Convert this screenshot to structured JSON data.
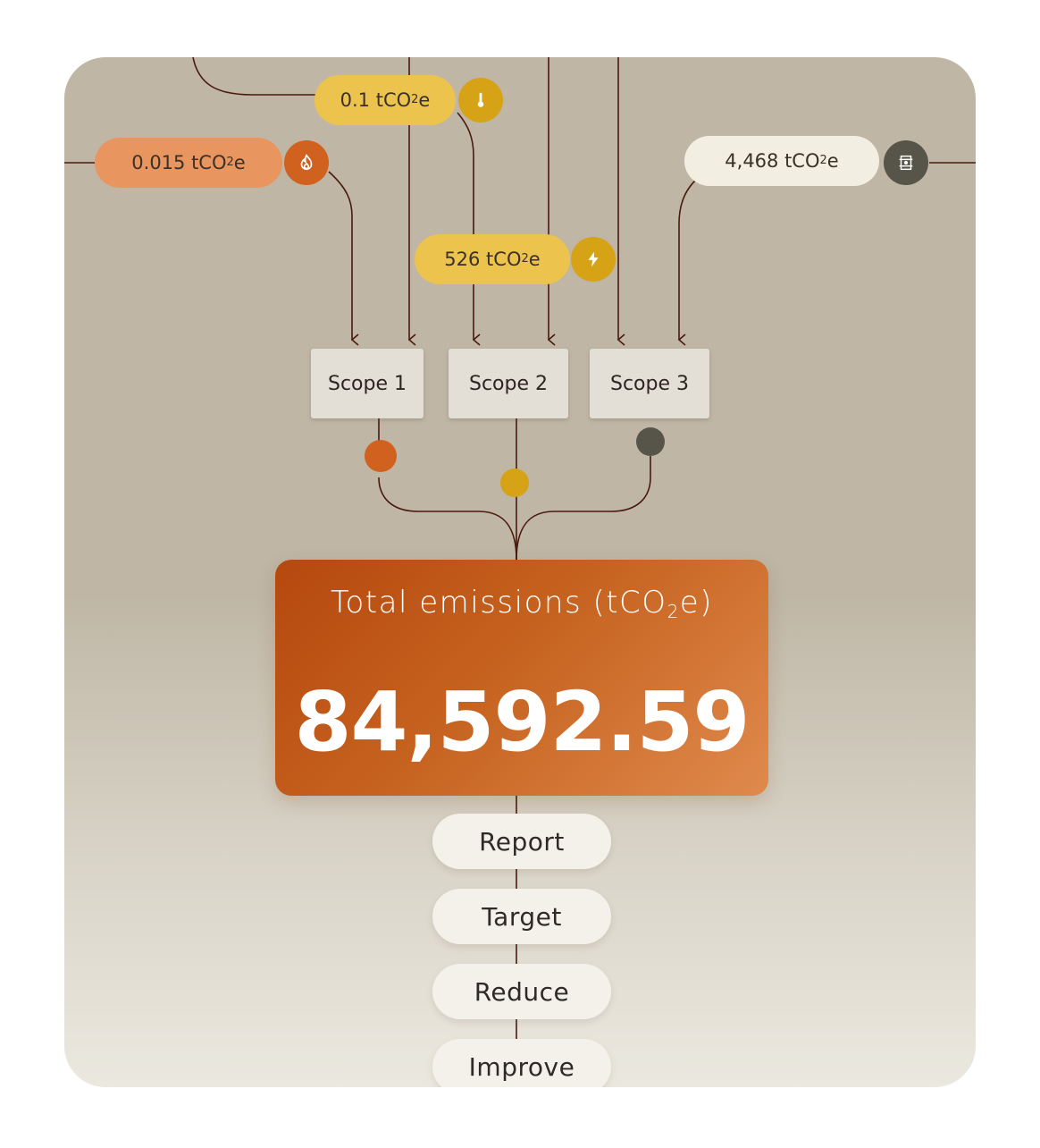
{
  "colors": {
    "background": "#bfb6a5",
    "line": "#4a1a0e",
    "orange_pill": "#e8955f",
    "orange_icon": "#d0611f",
    "yellow_pill": "#ecc34d",
    "yellow_icon": "#d6a317",
    "cream_pill": "#f2eee2",
    "dark_icon": "#57544a",
    "total_gradient_start": "#b5480e",
    "total_gradient_end": "#df8a4d"
  },
  "sources": [
    {
      "value": "0.015 tCO",
      "sub": "2",
      "suffix": "e",
      "icon": "flame-icon"
    },
    {
      "value": "0.1 tCO",
      "sub": "2",
      "suffix": "e",
      "icon": "thermometer-icon"
    },
    {
      "value": "526 tCO",
      "sub": "2",
      "suffix": "e",
      "icon": "lightning-icon"
    },
    {
      "value": "4,468 tCO",
      "sub": "2",
      "suffix": "e",
      "icon": "building-icon"
    }
  ],
  "scopes": [
    {
      "label": "Scope 1",
      "dot_color": "#d0611f"
    },
    {
      "label": "Scope 2",
      "dot_color": "#d6a317"
    },
    {
      "label": "Scope 3",
      "dot_color": "#57544a"
    }
  ],
  "total": {
    "label_pre": "Total emissions (tCO",
    "label_sub": "2",
    "label_post": "e)",
    "value": "84,592.59"
  },
  "actions": [
    "Report",
    "Target",
    "Reduce",
    "Improve"
  ]
}
